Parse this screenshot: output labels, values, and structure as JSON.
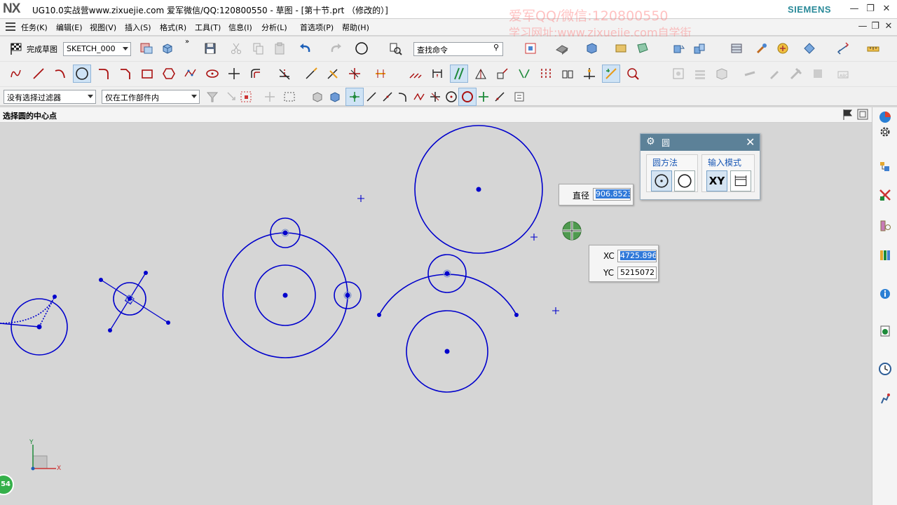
{
  "titlebar": {
    "logo": "NX",
    "title": "UG10.0实战营www.zixuejie.com 爱军微信/QQ:120800550 - 草图 - [第十节.prt （修改的）]",
    "brand": "SIEMENS"
  },
  "watermark": {
    "line1": "爱军QQ/微信:120800550",
    "line2": "学习网址:www.zixuejie.com自学街"
  },
  "menu": [
    "任务(K)",
    "编辑(E)",
    "视图(V)",
    "插入(S)",
    "格式(R)",
    "工具(T)",
    "信息(I)",
    "分析(L)",
    "首选项(P)",
    "帮助(H)"
  ],
  "toolbar": {
    "finish_sketch": "完成草图",
    "sketch_name": "SKETCH_000",
    "search_placeholder": "查找命令"
  },
  "filters": {
    "selection_filter": "没有选择过滤器",
    "scope": "仅在工作部件内"
  },
  "status": {
    "prompt": "选择圆的中心点"
  },
  "circle_dialog": {
    "title": "圆",
    "method_label": "圆方法",
    "input_mode_label": "输入模式",
    "xy_label": "XY"
  },
  "diameter_popup": {
    "label": "直径",
    "value": "906.8523"
  },
  "coord_popup": {
    "xc_label": "XC",
    "xc_value": "4725.896",
    "yc_label": "YC",
    "yc_value": "5215072"
  },
  "triad": {
    "x": "X",
    "y": "Y"
  },
  "badge": {
    "value": "54"
  },
  "colors": {
    "sketch_curve": "#0000cc",
    "dialog_header": "#5c8198",
    "selection_highlight": "#3079d9"
  }
}
